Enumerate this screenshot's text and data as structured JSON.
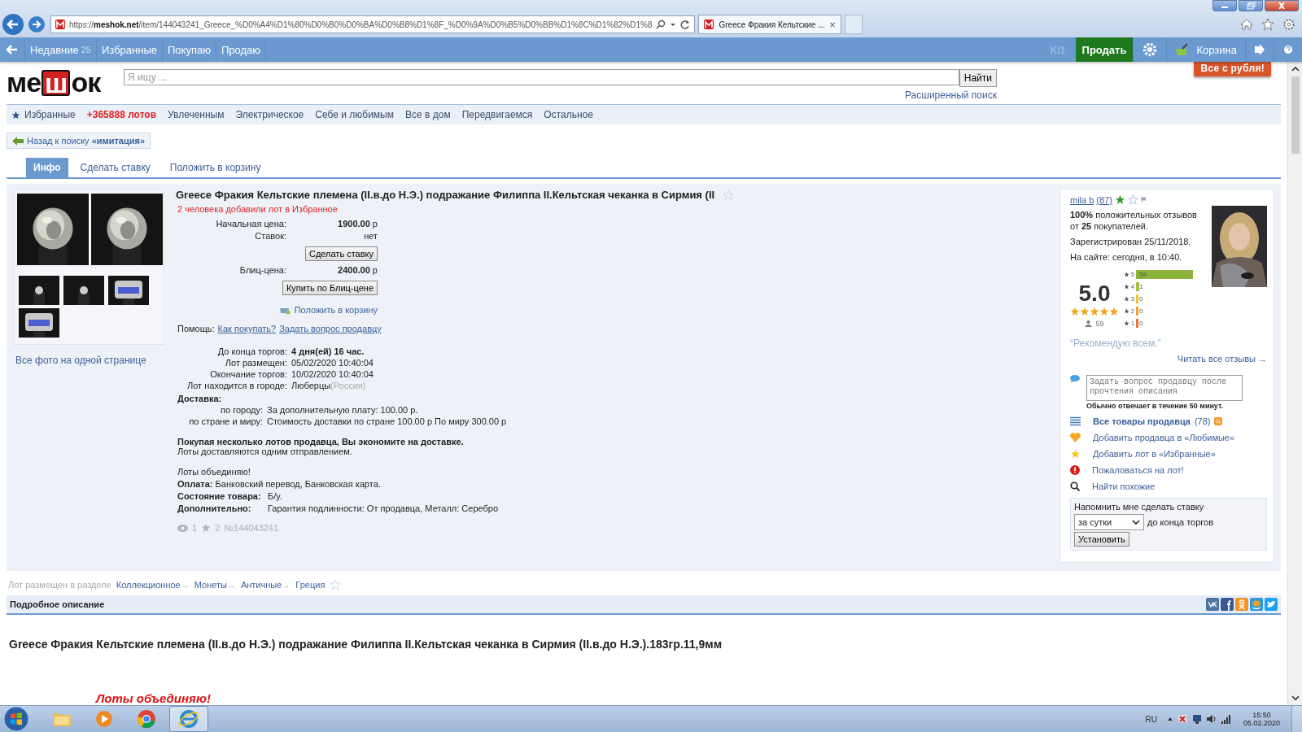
{
  "browser": {
    "url": "https://**meshok.net**/item/144043241_Greece_%D0%A4%D1%80%D0%B0%D0%BA%D0%B8%D1%8F_%D0%9A%D0%B5%D0%BB%D1%8C%D1%82%D1%8",
    "tab": "Greece Фракия Кельтские ...",
    "tab_close": "×"
  },
  "site_nav": {
    "items": [
      {
        "label": "Недавние",
        "count": "25"
      },
      {
        "label": "Избранные"
      },
      {
        "label": "Покупаю"
      },
      {
        "label": "Продаю"
      }
    ],
    "user": "Ki1",
    "sell": "Продать",
    "cart": "Корзина",
    "promo": "Все с рубля!"
  },
  "logo": [
    "ме",
    "ш",
    "ок"
  ],
  "search": {
    "placeholder": "Я ищу ...",
    "button": "Найти",
    "advanced": "Расширенный поиск"
  },
  "categories": [
    {
      "label": "Избранные",
      "kind": "favorites"
    },
    {
      "label": "+365888 лотов",
      "kind": "count"
    },
    {
      "label": "Увлеченным",
      "kind": "link"
    },
    {
      "label": "Электрическое",
      "kind": "link"
    },
    {
      "label": "Себе и любимым",
      "kind": "link"
    },
    {
      "label": "Все в дом",
      "kind": "link"
    },
    {
      "label": "Передвигаемся",
      "kind": "link"
    },
    {
      "label": "Остальное",
      "kind": "link"
    }
  ],
  "back": "Назад к поиску **«имитация»**",
  "tabs": [
    {
      "label": "Инфо",
      "selected": true
    },
    {
      "label": "Сделать ставку",
      "selected": false
    },
    {
      "label": "Положить в корзину",
      "selected": false
    }
  ],
  "photos": {
    "all_link": "Все фото на одной странице"
  },
  "lot": {
    "title": "Greece Фракия Кельтские племена (II.в.до Н.Э.) подражание Филиппа II.Кельтская чеканка в Сирмия (II",
    "watchers": "2 человека добавили лот в Избранное",
    "start_label": "Начальная цена:",
    "start_price": "1900.00",
    "currency": "р",
    "bids_label": "Ставок:",
    "bids": "нет",
    "bid_button": "Сделать ставку",
    "blitz_label": "Блиц-цена:",
    "blitz_price": "2400.00",
    "blitz_currency": "р",
    "blitz_button": "Купить по Блиц-цене",
    "cart_link": "Положить в корзину",
    "help_label": "Помощь:",
    "help_links": [
      "Как покупать?",
      "Задать вопрос продавцу"
    ],
    "details": [
      {
        "label": "До конца торгов:",
        "value": "**4 дня(ей) 16 час.**"
      },
      {
        "label": "Лот размещен:",
        "value": "05/02/2020 10:40:04"
      },
      {
        "label": "Окончание торгов:",
        "value": "10/02/2020 10:40:04"
      },
      {
        "label": "Лот находится в городе:",
        "value": "Люберцы",
        "note": "(Россия)"
      }
    ],
    "delivery_title": "Доставка:",
    "delivery": [
      {
        "label": "по городу:",
        "value": "За дополнительную плату: 100.00 р."
      },
      {
        "label": "по стране и миру:",
        "value": "Стоимость доставки по стране 100.00 р По миру 300.00 р"
      }
    ],
    "combine_bold": "Покупая несколько лотов продавца, Вы экономите на доставке.",
    "combine": "Лоты доставляются одним отправлением.",
    "note": "Лоты объединяю!",
    "payment": "**Оплата:** Банковский перевод, Банковская карта.",
    "condition_label": "Состояние товара:",
    "condition": "Б/у.",
    "extra_label": "Дополнительно:",
    "extra": "Гарантия подлинности: От продавца, Металл: Серебро",
    "views": "1",
    "favorites": "2",
    "number": "№144043241"
  },
  "seller": {
    "name": "mila b",
    "rating": "(87)",
    "feedback": "**100%** положительных отзывов от **25** покупателей.",
    "registered": "Зарегистрирован 25/11/2018.",
    "online": "На сайте: сегодня, в 10:40.",
    "score": "5.0",
    "stars": 5,
    "reviews": "59",
    "histogram": [
      {
        "star": "5",
        "count": "58",
        "color": "#8cb43c"
      },
      {
        "star": "4",
        "count": "1",
        "color": "#a6c43a"
      },
      {
        "star": "3",
        "count": "0",
        "color": "#f2c230"
      },
      {
        "star": "2",
        "count": "0",
        "color": "#f0a030"
      },
      {
        "star": "1",
        "count": "0",
        "color": "#e8703a"
      }
    ],
    "quote": "“Рекомендую всем.”",
    "all_reviews": "Читать все отзывы →",
    "question_placeholder": "Задать вопрос продавцу после прочтения описания",
    "response": "Обычно отвечает в течение 50 минут.",
    "actions": [
      {
        "kind": "list",
        "label": "Все товары продавца",
        "count": "(78)"
      },
      {
        "kind": "heart",
        "label": "Добавить продавца в «Любимые»"
      },
      {
        "kind": "star",
        "label": "Добавить лот в «Избранные»"
      },
      {
        "kind": "alert",
        "label": "Пожаловаться на лот!"
      },
      {
        "kind": "search",
        "label": "Найти похожие"
      }
    ],
    "reminder": {
      "title": "Напомнить мне сделать ставку",
      "select": "за сутки",
      "suffix": "до конца торгов",
      "button": "Установить"
    }
  },
  "breadcrumb": {
    "label": "Лот размещен в разделе",
    "separator": "→",
    "items": [
      "Коллекционное",
      "Монеты",
      "Античные",
      "Греция"
    ]
  },
  "description": {
    "header": "Подробное описание",
    "title": "Greece Фракия Кельтские племена (II.в.до Н.Э.) подражание  Филиппа II.Кельтская чеканка в Сирмия (II.в.до Н.Э.).183гр.11,9мм",
    "banner": "Лоты объединяю!"
  },
  "taskbar": {
    "apps": [
      {
        "kind": "folder",
        "selected": false
      },
      {
        "kind": "media",
        "selected": false
      },
      {
        "kind": "chrome",
        "selected": false
      },
      {
        "kind": "ie",
        "selected": true
      }
    ],
    "lang": "RU",
    "time": "15:50",
    "date": "05.02.2020"
  }
}
